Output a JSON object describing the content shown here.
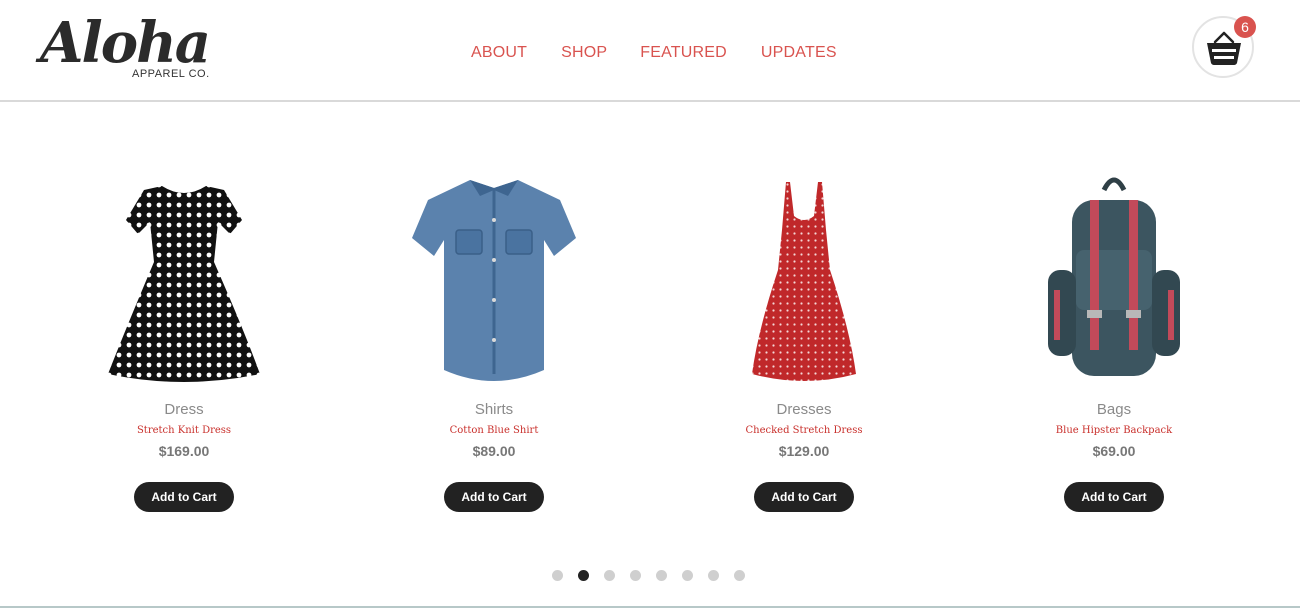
{
  "brand": {
    "logo_script": "Aloha",
    "logo_sub": "APPAREL CO."
  },
  "nav": {
    "items": [
      {
        "label": "ABOUT"
      },
      {
        "label": "SHOP"
      },
      {
        "label": "FEATURED"
      },
      {
        "label": "UPDATES"
      }
    ]
  },
  "cart": {
    "icon": "basket-icon",
    "count": "6"
  },
  "colors": {
    "accent": "#d9534f",
    "button": "#222222",
    "dot_active": "#222222",
    "dot_inactive": "#cfcfcf"
  },
  "products": [
    {
      "category": "Dress",
      "name": "Stretch Knit Dress",
      "price": "$169.00",
      "button": "Add to Cart",
      "image": "polka-dot-black-dress"
    },
    {
      "category": "Shirts",
      "name": "Cotton Blue Shirt",
      "price": "$89.00",
      "button": "Add to Cart",
      "image": "denim-shirt"
    },
    {
      "category": "Dresses",
      "name": "Checked Stretch Dress",
      "price": "$129.00",
      "button": "Add to Cart",
      "image": "red-polka-dress"
    },
    {
      "category": "Bags",
      "name": "Blue Hipster Backpack",
      "price": "$69.00",
      "button": "Add to Cart",
      "image": "teal-backpack"
    }
  ],
  "carousel": {
    "total_pages": 8,
    "active_index": 1
  }
}
